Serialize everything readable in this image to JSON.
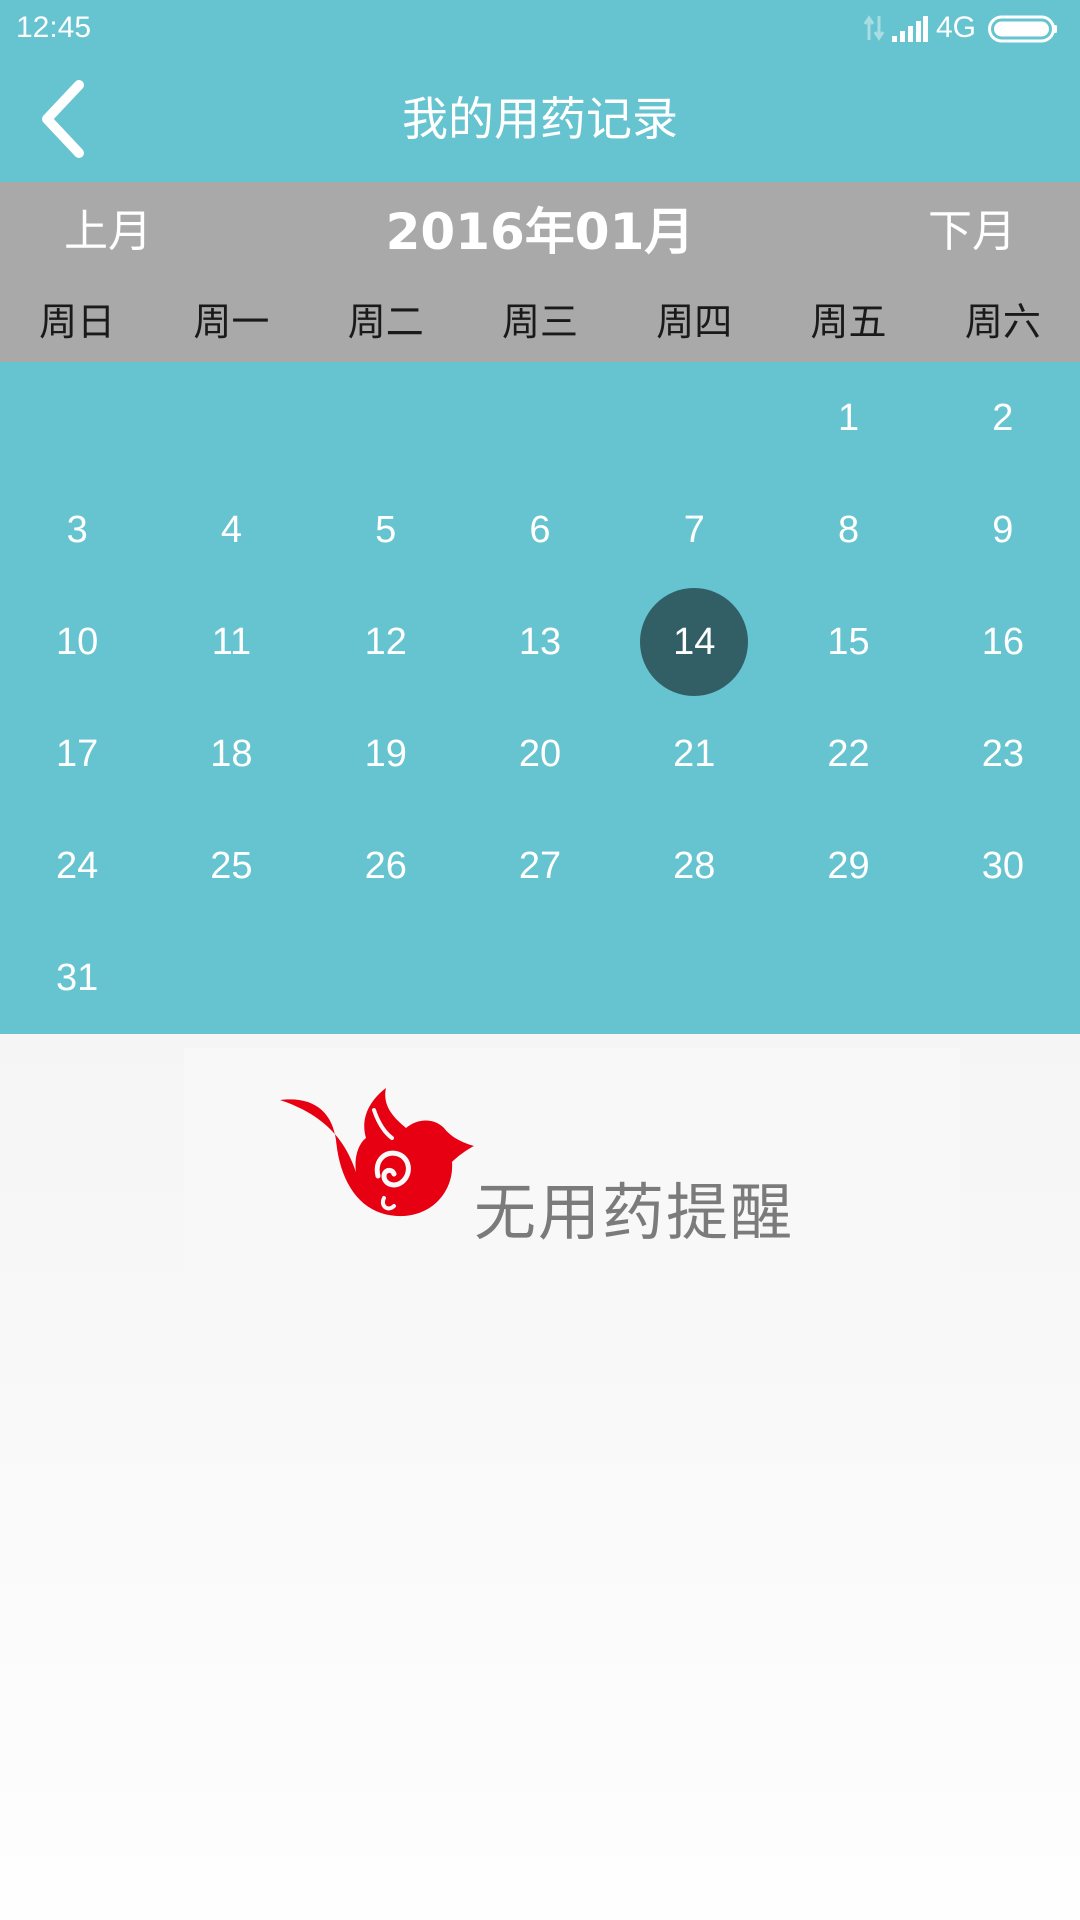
{
  "status_bar": {
    "time": "12:45",
    "network": "4G",
    "icons": [
      "data-transfer-icon",
      "signal-icon",
      "battery-icon"
    ]
  },
  "app_bar": {
    "title": "我的用药记录",
    "back_icon": "chevron-left-icon"
  },
  "calendar": {
    "prev_label": "上月",
    "next_label": "下月",
    "month_label": "2016年01月",
    "weekdays": [
      "周日",
      "周一",
      "周二",
      "周三",
      "周四",
      "周五",
      "周六"
    ],
    "first_weekday_index": 5,
    "days_in_month": 31,
    "selected_day": 14
  },
  "empty_state": {
    "logo_icon": "red-bird-logo-icon",
    "message": "无用药提醒"
  },
  "colors": {
    "primary": "#66c4d0",
    "header_gray": "#a9a9a9",
    "selected_day": "#325f66",
    "logo_red": "#e60012",
    "empty_text": "#7b7b7b"
  }
}
